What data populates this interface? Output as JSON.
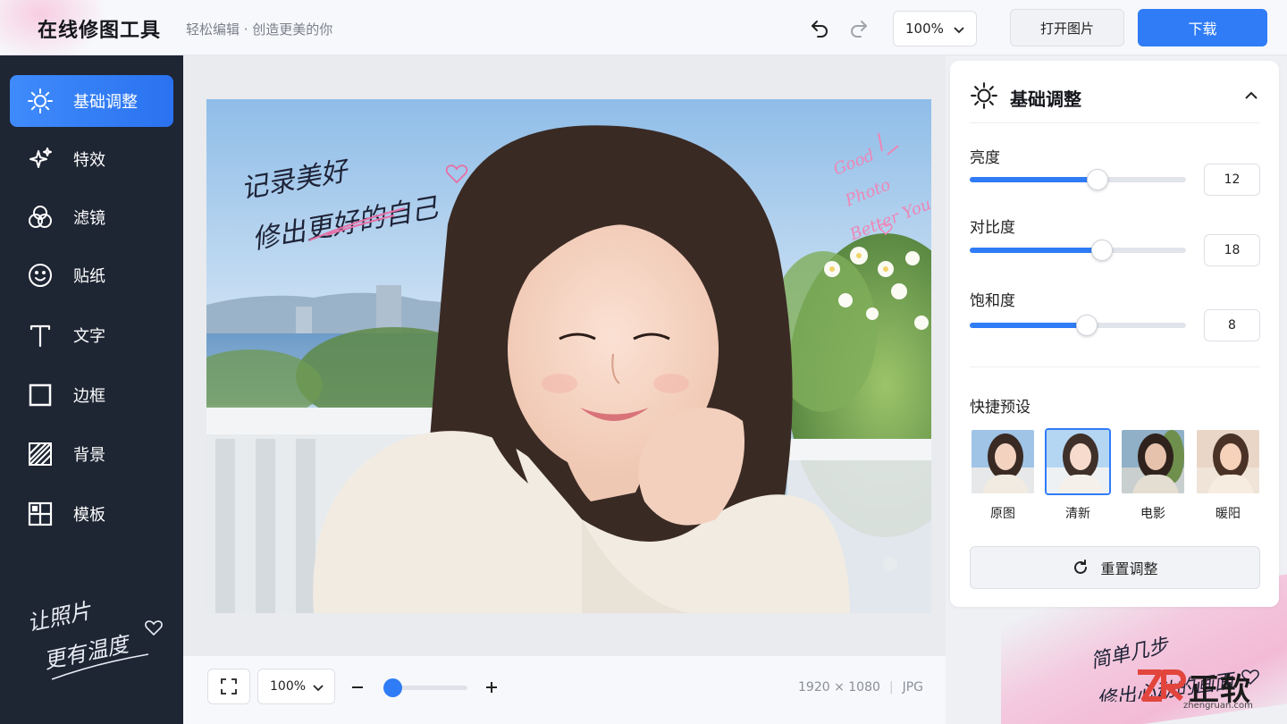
{
  "header": {
    "app_title": "在线修图工具",
    "subtitle": "轻松编辑 · 创造更美的你",
    "zoom": "100%",
    "open_label": "打开图片",
    "download_label": "下载"
  },
  "colors": {
    "accent": "#2f7cf6",
    "sidebar_bg": "#1e2533",
    "pink": "#f29ac4"
  },
  "sidebar": {
    "items": [
      {
        "label": "基础调整",
        "icon": "sun-icon",
        "active": true
      },
      {
        "label": "特效",
        "icon": "sparkle-icon",
        "active": false
      },
      {
        "label": "滤镜",
        "icon": "filter-circles-icon",
        "active": false
      },
      {
        "label": "贴纸",
        "icon": "smiley-icon",
        "active": false
      },
      {
        "label": "文字",
        "icon": "text-icon",
        "active": false
      },
      {
        "label": "边框",
        "icon": "frame-icon",
        "active": false
      },
      {
        "label": "背景",
        "icon": "background-hatch-icon",
        "active": false
      },
      {
        "label": "模板",
        "icon": "template-grid-icon",
        "active": false
      }
    ],
    "handwriting": [
      "让照片",
      "更有温度"
    ]
  },
  "photo": {
    "overlay_text_1": "记录美好",
    "overlay_text_2": "修出更好的自己",
    "overlay_en": [
      "Good",
      "Photo",
      "Better You"
    ]
  },
  "bottom": {
    "zoom": "100%",
    "zoom_level": 0.1,
    "dimensions": "1920 × 1080",
    "format": "JPG"
  },
  "panel": {
    "title": "基础调整",
    "adjustments": [
      {
        "label": "亮度",
        "value": "12",
        "fraction": 0.59
      },
      {
        "label": "对比度",
        "value": "18",
        "fraction": 0.61
      },
      {
        "label": "饱和度",
        "value": "8",
        "fraction": 0.54
      }
    ],
    "presets_title": "快捷预设",
    "presets": [
      {
        "label": "原图",
        "selected": false
      },
      {
        "label": "清新",
        "selected": true
      },
      {
        "label": "电影",
        "selected": false
      },
      {
        "label": "暖阳",
        "selected": false
      }
    ],
    "reset_label": "重置调整"
  },
  "footer": {
    "handwriting": [
      "简单几步",
      "修出心动的画面"
    ],
    "logo_text": "正软",
    "logo_url": "zhengruan.com"
  }
}
